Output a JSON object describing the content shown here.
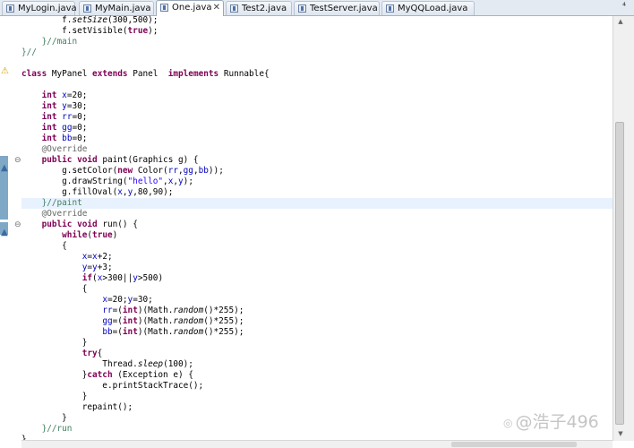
{
  "tabs": [
    {
      "label": "MyLogin.java",
      "active": false,
      "closable": false
    },
    {
      "label": "MyMain.java",
      "active": false,
      "closable": false
    },
    {
      "label": "One.java",
      "active": true,
      "closable": true,
      "close_label": "✕"
    },
    {
      "label": "Test2.java",
      "active": false,
      "closable": false
    },
    {
      "label": "TestServer.java",
      "active": false,
      "closable": false
    },
    {
      "label": "MyQQLoad.java",
      "active": false,
      "closable": false
    }
  ],
  "tab_menu_icon": "⁴",
  "editor": {
    "highlighted_line_index": 17,
    "lines": [
      [
        {
          "t": "        f."
        },
        {
          "t": "setSize",
          "c": "mi"
        },
        {
          "t": "(300,500);"
        }
      ],
      [
        {
          "t": "        f.setVisible("
        },
        {
          "t": "true",
          "c": "kw"
        },
        {
          "t": ");"
        }
      ],
      [
        {
          "t": "    }//main",
          "c": "cm"
        }
      ],
      [
        {
          "t": "}//",
          "c": "cm"
        }
      ],
      [
        {
          "t": ""
        }
      ],
      [
        {
          "t": "class",
          "c": "kw"
        },
        {
          "t": " MyPanel "
        },
        {
          "t": "extends",
          "c": "kw"
        },
        {
          "t": " Panel  "
        },
        {
          "t": "implements",
          "c": "kw"
        },
        {
          "t": " Runnable{"
        }
      ],
      [
        {
          "t": ""
        }
      ],
      [
        {
          "t": "    "
        },
        {
          "t": "int",
          "c": "kw"
        },
        {
          "t": " "
        },
        {
          "t": "x",
          "c": "fld"
        },
        {
          "t": "=20;"
        }
      ],
      [
        {
          "t": "    "
        },
        {
          "t": "int",
          "c": "kw"
        },
        {
          "t": " "
        },
        {
          "t": "y",
          "c": "fld"
        },
        {
          "t": "=30;"
        }
      ],
      [
        {
          "t": "    "
        },
        {
          "t": "int",
          "c": "kw"
        },
        {
          "t": " "
        },
        {
          "t": "rr",
          "c": "fld"
        },
        {
          "t": "=0;"
        }
      ],
      [
        {
          "t": "    "
        },
        {
          "t": "int",
          "c": "kw"
        },
        {
          "t": " "
        },
        {
          "t": "gg",
          "c": "fld"
        },
        {
          "t": "=0;"
        }
      ],
      [
        {
          "t": "    "
        },
        {
          "t": "int",
          "c": "kw"
        },
        {
          "t": " "
        },
        {
          "t": "bb",
          "c": "fld"
        },
        {
          "t": "=0;"
        }
      ],
      [
        {
          "t": "    @Override",
          "c": "an"
        }
      ],
      [
        {
          "t": "    "
        },
        {
          "t": "public",
          "c": "kw"
        },
        {
          "t": " "
        },
        {
          "t": "void",
          "c": "kw"
        },
        {
          "t": " paint(Graphics g) {"
        }
      ],
      [
        {
          "t": "        g.setColor("
        },
        {
          "t": "new",
          "c": "kw"
        },
        {
          "t": " Color("
        },
        {
          "t": "rr",
          "c": "fld"
        },
        {
          "t": ","
        },
        {
          "t": "gg",
          "c": "fld"
        },
        {
          "t": ","
        },
        {
          "t": "bb",
          "c": "fld"
        },
        {
          "t": "));"
        }
      ],
      [
        {
          "t": "        g.drawString("
        },
        {
          "t": "\"hello\"",
          "c": "str"
        },
        {
          "t": ","
        },
        {
          "t": "x",
          "c": "fld"
        },
        {
          "t": ","
        },
        {
          "t": "y",
          "c": "fld"
        },
        {
          "t": ");"
        }
      ],
      [
        {
          "t": "        g.fillOval("
        },
        {
          "t": "x",
          "c": "fld"
        },
        {
          "t": ","
        },
        {
          "t": "y",
          "c": "fld"
        },
        {
          "t": ",80,90);"
        }
      ],
      [
        {
          "t": "    }//paint",
          "c": "cm"
        }
      ],
      [
        {
          "t": "    @Override",
          "c": "an"
        }
      ],
      [
        {
          "t": "    "
        },
        {
          "t": "public",
          "c": "kw"
        },
        {
          "t": " "
        },
        {
          "t": "void",
          "c": "kw"
        },
        {
          "t": " run() {"
        }
      ],
      [
        {
          "t": "        "
        },
        {
          "t": "while",
          "c": "kw"
        },
        {
          "t": "("
        },
        {
          "t": "true",
          "c": "kw"
        },
        {
          "t": ")"
        }
      ],
      [
        {
          "t": "        {"
        }
      ],
      [
        {
          "t": "            "
        },
        {
          "t": "x",
          "c": "fld"
        },
        {
          "t": "="
        },
        {
          "t": "x",
          "c": "fld"
        },
        {
          "t": "+2;"
        }
      ],
      [
        {
          "t": "            "
        },
        {
          "t": "y",
          "c": "fld"
        },
        {
          "t": "="
        },
        {
          "t": "y",
          "c": "fld"
        },
        {
          "t": "+3;"
        }
      ],
      [
        {
          "t": "            "
        },
        {
          "t": "if",
          "c": "kw"
        },
        {
          "t": "("
        },
        {
          "t": "x",
          "c": "fld"
        },
        {
          "t": ">300||"
        },
        {
          "t": "y",
          "c": "fld"
        },
        {
          "t": ">500)"
        }
      ],
      [
        {
          "t": "            {"
        }
      ],
      [
        {
          "t": "                "
        },
        {
          "t": "x",
          "c": "fld"
        },
        {
          "t": "=20;"
        },
        {
          "t": "y",
          "c": "fld"
        },
        {
          "t": "=30;"
        }
      ],
      [
        {
          "t": "                "
        },
        {
          "t": "rr",
          "c": "fld"
        },
        {
          "t": "=("
        },
        {
          "t": "int",
          "c": "kw"
        },
        {
          "t": ")(Math."
        },
        {
          "t": "random",
          "c": "mi"
        },
        {
          "t": "()*255);"
        }
      ],
      [
        {
          "t": "                "
        },
        {
          "t": "gg",
          "c": "fld"
        },
        {
          "t": "=("
        },
        {
          "t": "int",
          "c": "kw"
        },
        {
          "t": ")(Math."
        },
        {
          "t": "random",
          "c": "mi"
        },
        {
          "t": "()*255);"
        }
      ],
      [
        {
          "t": "                "
        },
        {
          "t": "bb",
          "c": "fld"
        },
        {
          "t": "=("
        },
        {
          "t": "int",
          "c": "kw"
        },
        {
          "t": ")(Math."
        },
        {
          "t": "random",
          "c": "mi"
        },
        {
          "t": "()*255);"
        }
      ],
      [
        {
          "t": "            }"
        }
      ],
      [
        {
          "t": "            "
        },
        {
          "t": "try",
          "c": "kw"
        },
        {
          "t": "{"
        }
      ],
      [
        {
          "t": "                Thread."
        },
        {
          "t": "sleep",
          "c": "mi"
        },
        {
          "t": "(100);"
        }
      ],
      [
        {
          "t": "            }"
        },
        {
          "t": "catch",
          "c": "kw"
        },
        {
          "t": " (Exception e) {"
        }
      ],
      [
        {
          "t": "                e.printStackTrace();"
        }
      ],
      [
        {
          "t": "            }"
        }
      ],
      [
        {
          "t": "            repaint();"
        }
      ],
      [
        {
          "t": "        }"
        }
      ],
      [
        {
          "t": "    }//run",
          "c": "cm"
        }
      ],
      [
        {
          "t": "}"
        }
      ]
    ]
  },
  "gutter": {
    "fold_marks": [
      {
        "line": 13,
        "glyph": "⊖"
      },
      {
        "line": 19,
        "glyph": "⊖"
      }
    ],
    "override_marks": [
      {
        "line": 13,
        "glyph": "▲"
      },
      {
        "line": 19,
        "glyph": "▲"
      }
    ],
    "warning_icon": "warning-icon"
  },
  "watermark": {
    "logo": "◎",
    "text": "@浩子496"
  },
  "colors": {
    "keyword": "#7f0055",
    "comment": "#3f7f5f",
    "field": "#0000c0",
    "string": "#2a00ff",
    "annotation": "#646464",
    "current_line": "#e8f2fe",
    "quick_diff_bar": "#7fa8c6"
  }
}
